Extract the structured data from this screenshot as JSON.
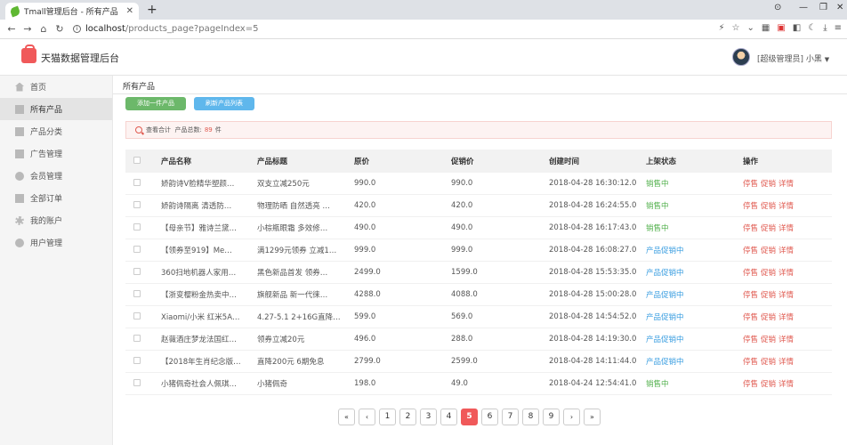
{
  "browser": {
    "tab_title": "Tmall管理后台 - 所有产品",
    "tab_close": "✕",
    "new_tab": "+",
    "url_host": "localhost",
    "url_path": "/products_page?pageIndex=5"
  },
  "header": {
    "brand": "天猫数据管理后台",
    "user": "[超级管理员] 小黑"
  },
  "sidebar": {
    "items": [
      {
        "label": "首页",
        "icon": "home-icon"
      },
      {
        "label": "所有产品",
        "icon": "product-icon"
      },
      {
        "label": "产品分类",
        "icon": "category-icon"
      },
      {
        "label": "广告管理",
        "icon": "ad-icon"
      },
      {
        "label": "会员管理",
        "icon": "user-icon"
      },
      {
        "label": "全部订单",
        "icon": "order-icon"
      },
      {
        "label": "我的账户",
        "icon": "gear-icon"
      },
      {
        "label": "用户管理",
        "icon": "user-icon"
      }
    ]
  },
  "main": {
    "breadcrumb": "所有产品",
    "add_button": "添加一件产品",
    "refresh_button": "刷新产品列表",
    "notice_prefix": "查看合计",
    "notice_label": "产品总数:",
    "notice_count": "89",
    "notice_unit": "件"
  },
  "table": {
    "headers": [
      "产品名称",
      "产品标题",
      "原价",
      "促销价",
      "创建时间",
      "上架状态",
      "操作"
    ],
    "ops": [
      "停售",
      "促销",
      "详情"
    ],
    "rows": [
      {
        "name": "娇韵诗V脸精华塑颜…",
        "title": "双支立减250元",
        "price": "990.0",
        "sale": "990.0",
        "time": "2018-04-28 16:30:12.0",
        "status": "销售中",
        "status_type": "sale"
      },
      {
        "name": "娇韵诗隔离 清透防…",
        "title": "物理防晒 自然透亮 …",
        "price": "420.0",
        "sale": "420.0",
        "time": "2018-04-28 16:24:55.0",
        "status": "销售中",
        "status_type": "sale"
      },
      {
        "name": "【母亲节】雅诗兰黛…",
        "title": "小棕瓶眼霜 多效修…",
        "price": "490.0",
        "sale": "490.0",
        "time": "2018-04-28 16:17:43.0",
        "status": "销售中",
        "status_type": "sale"
      },
      {
        "name": "【领券至919】Me…",
        "title": "满1299元领券 立减1…",
        "price": "999.0",
        "sale": "999.0",
        "time": "2018-04-28 16:08:27.0",
        "status": "产品促销中",
        "status_type": "promo"
      },
      {
        "name": "360扫地机器人家用…",
        "title": "黑色新品首发 领券…",
        "price": "2499.0",
        "sale": "1599.0",
        "time": "2018-04-28 15:53:35.0",
        "status": "产品促销中",
        "status_type": "promo"
      },
      {
        "name": "【浙变樱粉金热卖中…",
        "title": "旗舰新品 新一代徕…",
        "price": "4288.0",
        "sale": "4088.0",
        "time": "2018-04-28 15:00:28.0",
        "status": "产品促销中",
        "status_type": "promo"
      },
      {
        "name": "Xiaomi/小米 红米5A…",
        "title": "4.27-5.1 2+16G直降…",
        "price": "599.0",
        "sale": "569.0",
        "time": "2018-04-28 14:54:52.0",
        "status": "产品促销中",
        "status_type": "promo"
      },
      {
        "name": "赵薇酒庄梦龙法国红…",
        "title": "领券立减20元",
        "price": "496.0",
        "sale": "288.0",
        "time": "2018-04-28 14:19:30.0",
        "status": "产品促销中",
        "status_type": "promo"
      },
      {
        "name": "【2018年生肖纪念版…",
        "title": "直降200元 6期免息",
        "price": "2799.0",
        "sale": "2599.0",
        "time": "2018-04-28 14:11:44.0",
        "status": "产品促销中",
        "status_type": "promo"
      },
      {
        "name": "小猪佩奇社会人佩琪…",
        "title": "小猪佩奇",
        "price": "198.0",
        "sale": "49.0",
        "time": "2018-04-24 12:54:41.0",
        "status": "销售中",
        "status_type": "sale"
      }
    ]
  },
  "pagination": {
    "first": "«",
    "prev": "‹",
    "pages": [
      "1",
      "2",
      "3",
      "4",
      "5",
      "6",
      "7",
      "8",
      "9"
    ],
    "current": "5",
    "next": "›",
    "last": "»"
  },
  "colors": {
    "accent": "#f0595a",
    "sale_status": "#52b04c",
    "promo_status": "#3b9ee0",
    "add_button": "#6cb86a",
    "refresh_button": "#5fb7ec"
  }
}
